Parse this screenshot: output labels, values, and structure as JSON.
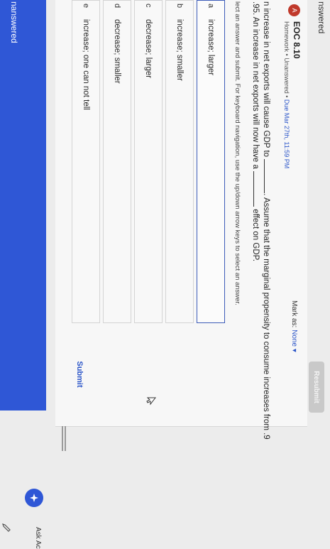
{
  "top": {
    "status_partial": "nswered",
    "resubmit_label": "Resubmit"
  },
  "item": {
    "badge": "A",
    "title": "EOC 8.10",
    "type": "Homework",
    "status": "Unanswered",
    "due": "Due Mar 27th, 11:59 PM",
    "mark_as_label": "Mark as:",
    "mark_as_value": "None"
  },
  "question": {
    "line1_a": "n increase in net exports will cause GDP to",
    "line1_b": ". Assume that the marginal propensity to consume increases from .9",
    "line2_a": ".95. An increase in net exports will now have a",
    "line2_b": "effect on GDP."
  },
  "instructions": "lect an answer and submit. For keyboard navigation, use the up/down arrow keys to select an answer.",
  "choices": [
    {
      "letter": "a",
      "text": "increase; larger"
    },
    {
      "letter": "b",
      "text": "increase; smaller"
    },
    {
      "letter": "c",
      "text": "decrease; larger"
    },
    {
      "letter": "d",
      "text": "decrease; smaller"
    },
    {
      "letter": "e",
      "text": "increase; one can not tell"
    }
  ],
  "submit_label": "Submit",
  "bottom": {
    "status_partial": "nanswered"
  },
  "ask_label": "Ask Ac",
  "colors": {
    "accent": "#2f57d6",
    "badge": "#c0392b",
    "link": "#2b55c8"
  },
  "icons": {
    "assistant": "assistant-icon",
    "pencil": "pencil-icon",
    "cursor": "cursor-icon"
  }
}
